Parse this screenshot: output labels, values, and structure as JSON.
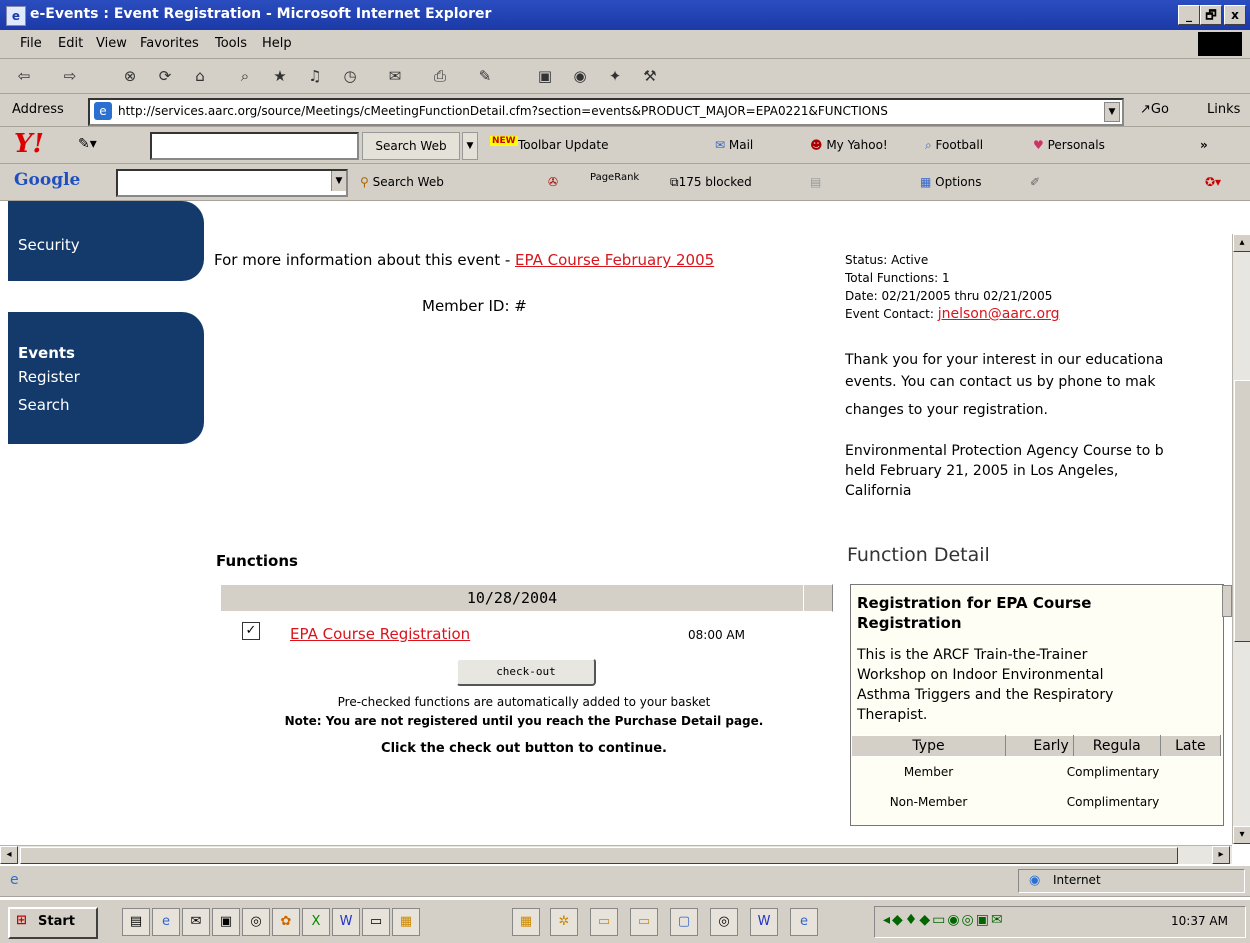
{
  "window": {
    "title": "e-Events : Event Registration - Microsoft Internet Explorer",
    "minimize": "_",
    "maximize": "🗗",
    "close": "x"
  },
  "menu": [
    "File",
    "Edit",
    "View",
    "Favorites",
    "Tools",
    "Help"
  ],
  "address": {
    "label": "Address",
    "url": "http://services.aarc.org/source/Meetings/cMeetingFunctionDetail.cfm?section=events&PRODUCT_MAJOR=EPA0221&FUNCTIONS",
    "go": "Go",
    "links": "Links"
  },
  "yahoo_toolbar": {
    "logo": "Y!",
    "search_button": "Search Web",
    "update": "Toolbar Update",
    "new_badge": "NEW",
    "mail": "Mail",
    "my_yahoo": "My Yahoo!",
    "football": "Football",
    "personals": "Personals",
    "more": "»"
  },
  "google_toolbar": {
    "logo": "Google",
    "search_button": "Search Web",
    "pagerank": "PageRank",
    "blocked": "175 blocked",
    "options": "Options"
  },
  "nav": {
    "security": "Security",
    "events_heading": "Events",
    "register": "Register",
    "search": "Search"
  },
  "event": {
    "info_prefix": "For more information about this event - ",
    "info_link": "EPA Course February 2005",
    "member_id": "Member ID: #",
    "status": "Status: Active",
    "total_functions": "Total Functions: 1",
    "date": "Date: 02/21/2005 thru 02/21/2005",
    "contact_label": "Event Contact: ",
    "contact_email": "jnelson@aarc.org",
    "thanks_line1": "Thank you for your interest in our educationa",
    "thanks_line2": "events. You can contact us by phone to mak",
    "thanks_line3": "changes to your registration.",
    "desc_line1": "Environmental Protection Agency Course to b",
    "desc_line2": "held February 21, 2005 in Los Angeles,",
    "desc_line3": "California"
  },
  "functions": {
    "heading": "Functions",
    "date_header": "10/28/2004",
    "item_name": "EPA Course Registration",
    "item_time": "08:00 AM",
    "checkout": "check-out",
    "note1": "Pre-checked functions are automatically added to your basket",
    "note2": "Note: You are not registered until you reach the Purchase Detail page.",
    "note3": "Click the check out button to continue."
  },
  "function_detail": {
    "heading": "Function Detail",
    "title_line1": "Registration for EPA Course",
    "title_line2": "Registration",
    "desc_line1": "This is the ARCF Train-the-Trainer",
    "desc_line2": "Workshop on Indoor Environmental",
    "desc_line3": "Asthma Triggers and the Respiratory",
    "desc_line4": "Therapist.",
    "columns": [
      "Type",
      "Early",
      "Regula",
      "Late"
    ],
    "rows": [
      {
        "type": "Member",
        "price": "Complimentary"
      },
      {
        "type": "Non-Member",
        "price": "Complimentary"
      }
    ]
  },
  "status_bar": {
    "zone": "Internet"
  },
  "taskbar": {
    "start": "Start",
    "clock": "10:37 AM"
  },
  "colors": {
    "nav_bg": "#143a6b",
    "link": "#d9141c",
    "titlebar": "#1c3aa8"
  }
}
